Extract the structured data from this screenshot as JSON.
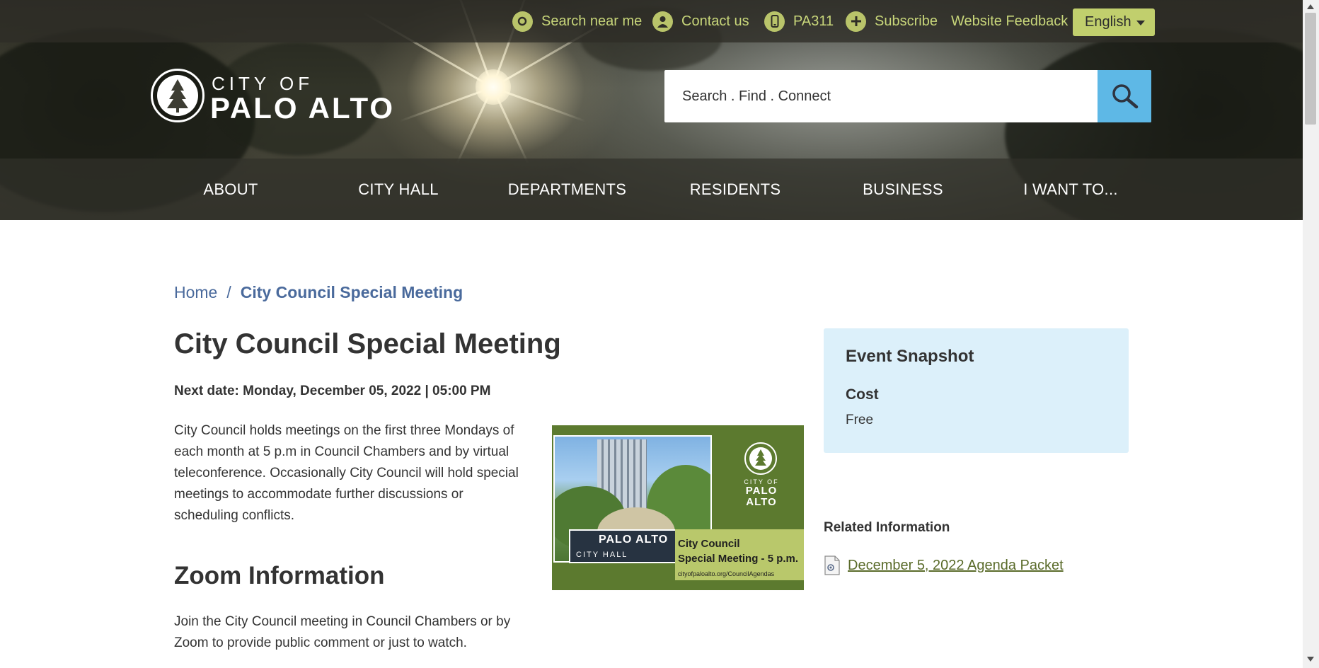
{
  "utility_bar": {
    "links": [
      {
        "label": "Search near me",
        "icon": "location-search-icon"
      },
      {
        "label": "Contact us",
        "icon": "person-icon"
      },
      {
        "label": "PA311",
        "icon": "mobile-phone-icon"
      },
      {
        "label": "Subscribe",
        "icon": "plus-circle-icon"
      },
      {
        "label": "Website Feedback",
        "icon": ""
      }
    ],
    "language": "English"
  },
  "logo": {
    "line1": "CITY OF",
    "line2": "PALO ALTO"
  },
  "search": {
    "placeholder": "Search . Find . Connect",
    "button_icon": "magnifier-icon"
  },
  "nav": {
    "items": [
      "ABOUT",
      "CITY HALL",
      "DEPARTMENTS",
      "RESIDENTS",
      "BUSINESS",
      "I WANT TO..."
    ]
  },
  "breadcrumb": {
    "home": "Home",
    "separator": "/",
    "current": "City Council Special Meeting"
  },
  "event": {
    "title": "City Council Special Meeting",
    "next_date": "Next date: Monday, December 05, 2022 | 05:00 PM",
    "description": "City Council holds meetings on the first three Mondays of each month at 5 p.m in Council Chambers and by virtual teleconference. Occasionally City Council will hold special meetings to accommodate further discussions or scheduling conflicts."
  },
  "zoom": {
    "heading": "Zoom Information",
    "text": "Join the City Council meeting in Council Chambers or by Zoom to provide public comment or just to watch."
  },
  "promo_image": {
    "seal_line1": "CITY OF",
    "seal_line2": "PALO ALTO",
    "sign_text": "PALO ALTO",
    "sign_sub": "CITY HALL",
    "caption_line1": "City Council",
    "caption_line2": "Special Meeting - 5 p.m.",
    "caption_url": "cityofpaloalto.org/CouncilAgendas"
  },
  "snapshot": {
    "title": "Event Snapshot",
    "cost_label": "Cost",
    "cost_value": "Free"
  },
  "related": {
    "heading": "Related Information",
    "link": "December 5, 2022 Agenda Packet"
  },
  "colors": {
    "accent_green": "#c1cf6d",
    "link_blue": "#4a6a9c",
    "search_button": "#5eb8e6",
    "snapshot_bg": "#dcf0fa"
  }
}
